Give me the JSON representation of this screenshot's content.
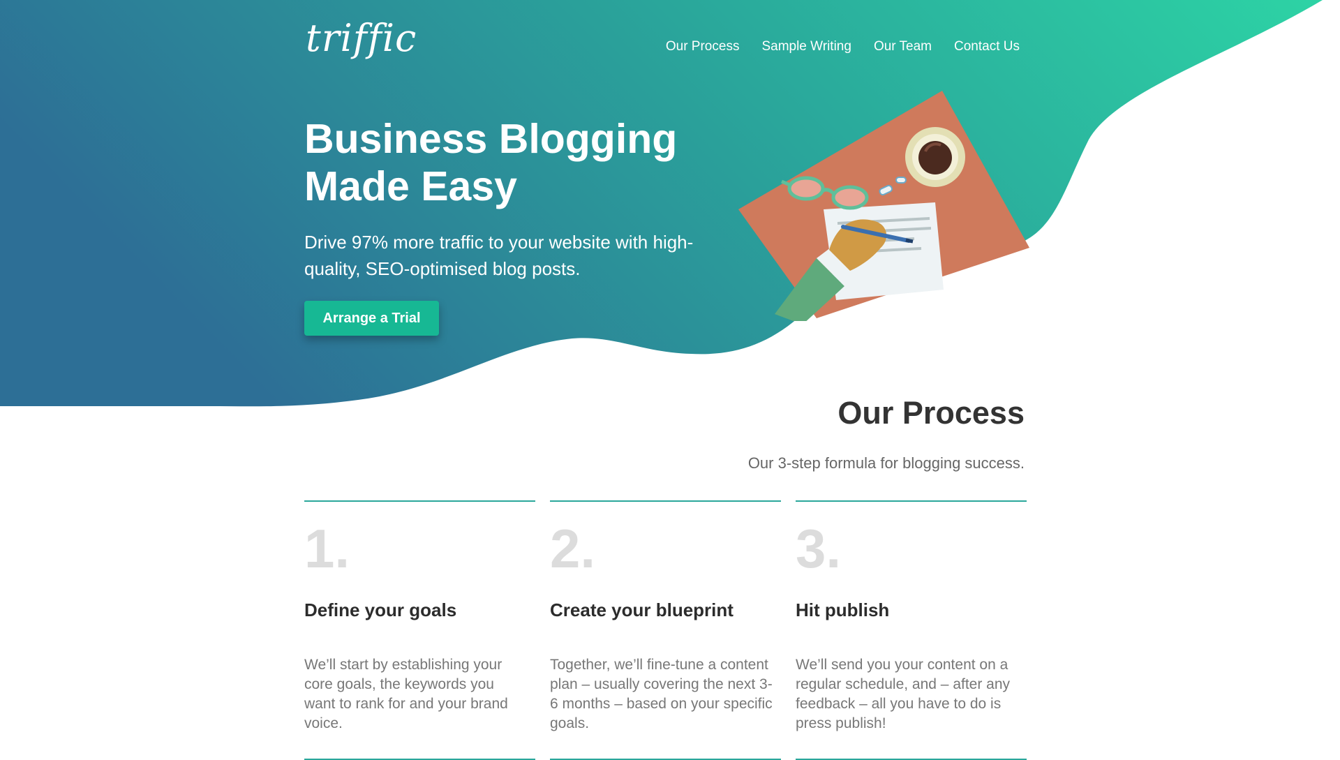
{
  "brand": {
    "logo": "triffic"
  },
  "nav": {
    "items": [
      {
        "label": "Our Process"
      },
      {
        "label": "Sample Writing"
      },
      {
        "label": "Our Team"
      },
      {
        "label": "Contact Us"
      }
    ]
  },
  "hero": {
    "title_line1": "Business Blogging",
    "title_line2": "Made Easy",
    "subtitle": "Drive 97% more traffic to your website with high-quality, SEO-optimised blog posts.",
    "cta_label": "Arrange a Trial",
    "illustration_icon": "desk-writing-illustration"
  },
  "process": {
    "title": "Our Process",
    "subtitle": "Our 3-step formula for blogging success.",
    "steps": [
      {
        "number": "1.",
        "title": "Define your goals",
        "text": "We’ll start by establishing your core goals, the keywords you want to rank for and your brand voice."
      },
      {
        "number": "2.",
        "title": "Create your blueprint",
        "text": "Together, we’ll fine-tune a content plan – usually covering the next 3-6 months – based on your specific goals."
      },
      {
        "number": "3.",
        "title": "Hit publish",
        "text": "We’ll send you your content on a regular schedule, and – after any feedback – all you have to do is press publish!"
      }
    ]
  },
  "colors": {
    "gradient_start": "#2d6f96",
    "gradient_end": "#2dd3a5",
    "accent": "#17b894",
    "divider": "#2aa79b",
    "desk": "#cf7a5c"
  }
}
